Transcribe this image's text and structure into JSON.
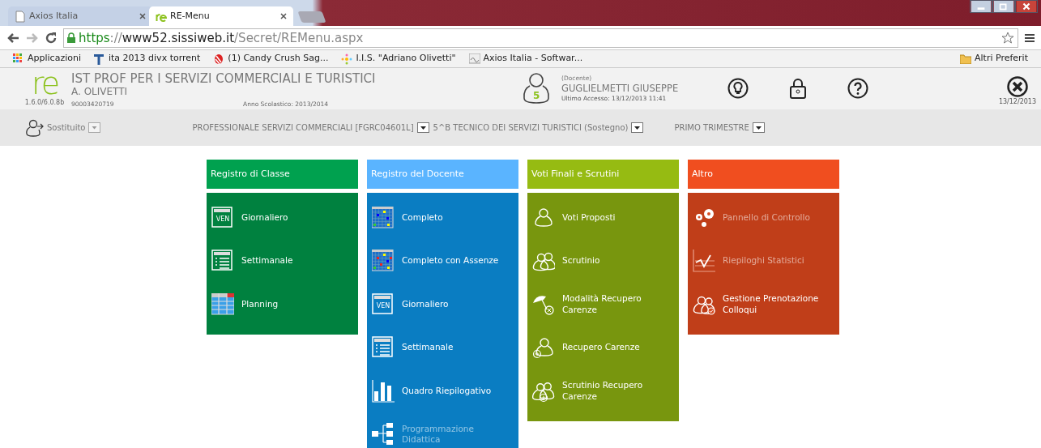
{
  "browser": {
    "tabs": [
      {
        "title": "Axios Italia",
        "selected": false
      },
      {
        "title": "RE-Menu",
        "selected": true
      }
    ],
    "url": {
      "scheme": "https",
      "sep": "://",
      "host": "www52.sissiweb.it",
      "path": "/Secret/REMenu.aspx"
    },
    "bookmarks": [
      {
        "label": "Applicazioni"
      },
      {
        "label": "ita 2013 divx torrent"
      },
      {
        "label": "(1) Candy Crush Sag..."
      },
      {
        "label": "I.I.S. \"Adriano Olivetti\""
      },
      {
        "label": "Axios Italia - Softwar..."
      }
    ],
    "other_bookmarks": "Altri Preferit"
  },
  "header": {
    "logo": "re",
    "version": "1.6.0/6.0.8b",
    "school": "IST PROF PER I SERVIZI COMMERCIALI E TURISTICI",
    "school_sub": "A. OLIVETTI",
    "code": "90003420719",
    "year": "Anno Scolastico: 2013/2014",
    "user": {
      "badge": "5",
      "role": "(Docente)",
      "name": "GUGLIELMETTI GIUSEPPE",
      "last_access": "Ultimo Accesso: 13/12/2013 11:41"
    },
    "exit_date": "13/12/2013"
  },
  "subbar": {
    "substitute": "Sostituito",
    "course": "PROFESSIONALE SERVIZI COMMERCIALI [FGRC04601L]",
    "class": "5^B TECNICO DEI SERVIZI TURISTICI (Sostegno)",
    "period": "PRIMO TRIMESTRE"
  },
  "groups": [
    {
      "title": "Registro di Classe",
      "color": "#00a14f",
      "items": [
        {
          "label": "Giornaliero",
          "kind": "day",
          "icon_text": "VEN",
          "disabled": false
        },
        {
          "label": "Settimanale",
          "kind": "week",
          "disabled": false
        },
        {
          "label": "Planning",
          "kind": "planning",
          "disabled": false
        }
      ]
    },
    {
      "title": "Registro del Docente",
      "color": "#5ab4ff",
      "items": [
        {
          "label": "Completo",
          "kind": "grid",
          "disabled": false
        },
        {
          "label": "Completo con Assenze",
          "kind": "grid-abs",
          "disabled": false
        },
        {
          "label": "Giornaliero",
          "kind": "day",
          "icon_text": "VEN",
          "disabled": false
        },
        {
          "label": "Settimanale",
          "kind": "week",
          "disabled": false
        },
        {
          "label": "Quadro Riepilogativo",
          "kind": "bars",
          "disabled": false
        },
        {
          "label": "Programmazione Didattica",
          "kind": "tree",
          "disabled": true
        }
      ]
    },
    {
      "title": "Voti Finali e Scrutini",
      "color": "#96bb12",
      "items": [
        {
          "label": "Voti Proposti",
          "kind": "person",
          "disabled": false
        },
        {
          "label": "Scrutinio",
          "kind": "people",
          "disabled": false
        },
        {
          "label": "Modalità Recupero Carenze",
          "kind": "umbrella",
          "disabled": false
        },
        {
          "label": "Recupero Carenze",
          "kind": "person-plus",
          "disabled": false
        },
        {
          "label": "Scrutinio Recupero Carenze",
          "kind": "people-plus",
          "disabled": false
        }
      ]
    },
    {
      "title": "Altro",
      "color": "#f04e1f",
      "items": [
        {
          "label": "Pannello di Controllo",
          "kind": "gears",
          "disabled": true
        },
        {
          "label": "Riepiloghi Statistici",
          "kind": "stats",
          "disabled": true
        },
        {
          "label": "Gestione Prenotazione Colloqui",
          "kind": "people-check",
          "disabled": false
        }
      ]
    }
  ]
}
